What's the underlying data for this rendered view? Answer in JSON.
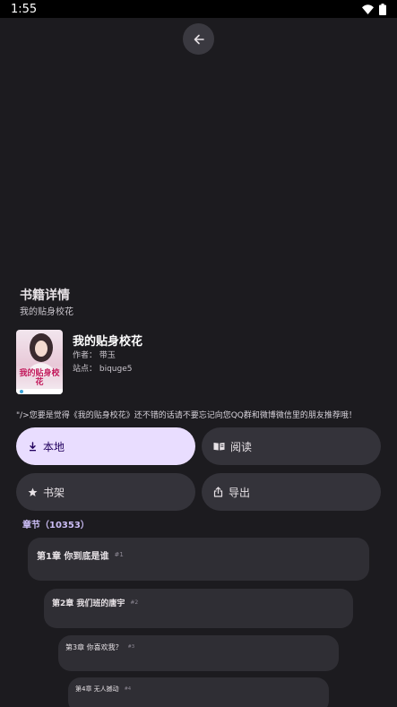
{
  "status_bar": {
    "time": "1:55",
    "icons": [
      "wifi-icon",
      "battery-icon"
    ]
  },
  "header": {
    "title": "书籍详情",
    "subtitle": "我的贴身校花"
  },
  "book": {
    "cover_text": "我的贴身校花",
    "title": "我的贴身校花",
    "author": "作者：  带玉",
    "site": "站点：  biquge5",
    "description": "\"/>您要是觉得《我的贴身校花》还不错的话请不要忘记向您QQ群和微博微信里的朋友推荐哦！"
  },
  "actions": {
    "local": "本地",
    "read": "阅读",
    "shelf": "书架",
    "export": "导出"
  },
  "chapters": {
    "label": "章节（10353）",
    "items": [
      {
        "title": "第1章 你到底是谁",
        "num": "#1"
      },
      {
        "title": "第2章 我们班的唐宇",
        "num": "#2"
      },
      {
        "title": "第3章 你喜欢我？",
        "num": "#3"
      },
      {
        "title": "第4章 无人撼动",
        "num": "#4"
      }
    ]
  },
  "colors": {
    "background": "#1c1b1f",
    "primary_container": "#e9ddff",
    "surface_variant": "#34333a",
    "accent_label": "#cbbdf5"
  }
}
